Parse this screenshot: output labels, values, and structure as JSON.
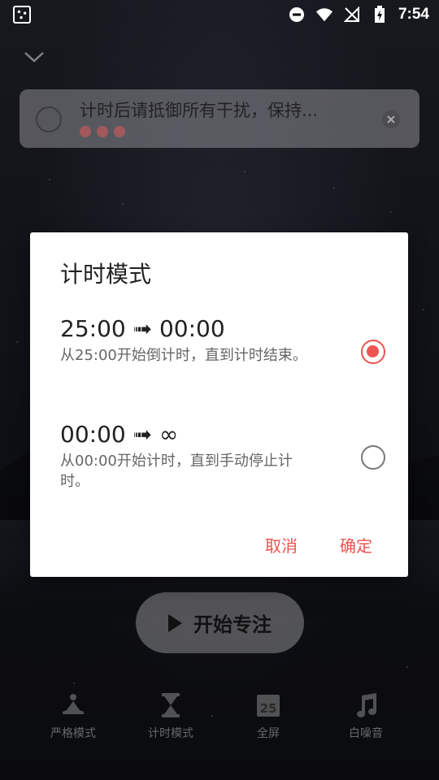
{
  "status_bar": {
    "time": "7:54",
    "icons": [
      "app-notification-icon",
      "do-not-disturb-icon",
      "wifi-icon",
      "no-signal-icon",
      "battery-charging-icon"
    ]
  },
  "task": {
    "text": "计时后请抵御所有干扰，保持...",
    "priority_dots": 3
  },
  "dialog": {
    "title": "计时模式",
    "options": [
      {
        "title": "25:00 ➟ 00:00",
        "desc": "从25:00开始倒计时，直到计时结束。",
        "selected": true
      },
      {
        "title": "00:00 ➟ ∞",
        "desc": "从00:00开始计时，直到手动停止计时。",
        "selected": false
      }
    ],
    "cancel_label": "取消",
    "confirm_label": "确定"
  },
  "start_button": {
    "label": "开始专注"
  },
  "bottom_nav": {
    "items": [
      {
        "label": "严格模式",
        "icon": "meditation-icon"
      },
      {
        "label": "计时模式",
        "icon": "hourglass-icon"
      },
      {
        "label": "全屏",
        "icon": "calendar-25-icon",
        "badge": "25"
      },
      {
        "label": "白噪音",
        "icon": "music-note-icon"
      }
    ]
  },
  "colors": {
    "accent": "#ef5350"
  }
}
